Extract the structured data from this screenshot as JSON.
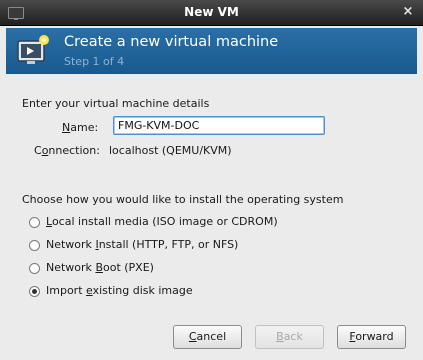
{
  "window": {
    "title": "New VM"
  },
  "header": {
    "title": "Create a new virtual machine",
    "step": "Step 1 of 4"
  },
  "details": {
    "heading": "Enter your virtual machine details",
    "name_label_mnemonic": "N",
    "name_label_rest": "ame:",
    "name_value": "FMG-KVM-DOC",
    "connection_label_pre": "C",
    "connection_label_mnemonic": "o",
    "connection_label_rest": "nnection:",
    "connection_value": "localhost (QEMU/KVM)"
  },
  "install": {
    "heading": "Choose how you would like to install the operating system",
    "options": [
      {
        "pre": "",
        "mnemonic": "L",
        "rest": "ocal install media (ISO image or CDROM)",
        "checked": false
      },
      {
        "pre": "Network ",
        "mnemonic": "I",
        "rest": "nstall (HTTP, FTP, or NFS)",
        "checked": false
      },
      {
        "pre": "Network ",
        "mnemonic": "B",
        "rest": "oot (PXE)",
        "checked": false
      },
      {
        "pre": "Import ",
        "mnemonic": "e",
        "rest": "xisting disk image",
        "checked": true
      }
    ]
  },
  "buttons": {
    "cancel": {
      "mnemonic": "C",
      "rest": "ancel"
    },
    "back": {
      "mnemonic": "B",
      "rest": "ack",
      "enabled": false
    },
    "forward": {
      "mnemonic": "F",
      "rest": "orward"
    }
  },
  "icons": {
    "app": "monitor-icon",
    "close": "close-icon",
    "wizard": "new-vm-icon"
  },
  "colors": {
    "header_bg": "#1f6499",
    "step_text": "#8db3d6",
    "input_focus": "#4e8fcf"
  }
}
